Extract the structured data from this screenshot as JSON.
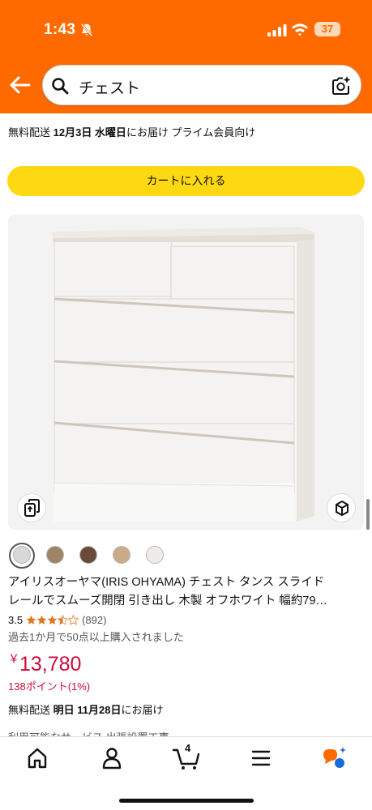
{
  "status_bar": {
    "time": "1:43",
    "battery": "37"
  },
  "search": {
    "query": "チェスト"
  },
  "delivery_top": {
    "prefix": "無料配送 ",
    "date": "12月3日 水曜日",
    "suffix": "にお届け プライム会員向け"
  },
  "cart_button": {
    "label": "カートに入れる"
  },
  "swatches": [
    {
      "color": "#d8d8d8",
      "selected": true
    },
    {
      "color": "#a08466"
    },
    {
      "color": "#6b4a3a"
    },
    {
      "color": "#c9ab88"
    },
    {
      "color": "#efebe6"
    }
  ],
  "product": {
    "title_line1": "アイリスオーヤマ(IRIS OHYAMA) チェスト タンス スライド",
    "title_line2": "レールでスムーズ開閉 引き出し 木製 オフホワイト 幅約79…",
    "rating": "3.5",
    "rating_count": "(892)",
    "bought_text": "過去1か月で50点以上購入されました",
    "price_symbol": "￥",
    "price_value": "13,780",
    "points": "138ポイント(1%)"
  },
  "delivery_bottom": {
    "prefix": "無料配送 ",
    "date": "明日 11月28日",
    "suffix": "にお届け"
  },
  "cut_text": "利用可能なサービス 出張設置工事",
  "bottom_nav": {
    "cart_count": "4"
  },
  "colors": {
    "header": "#ff6a00",
    "cart_button": "#ffd814",
    "price": "#cc0c39",
    "stars": "#de7921"
  }
}
